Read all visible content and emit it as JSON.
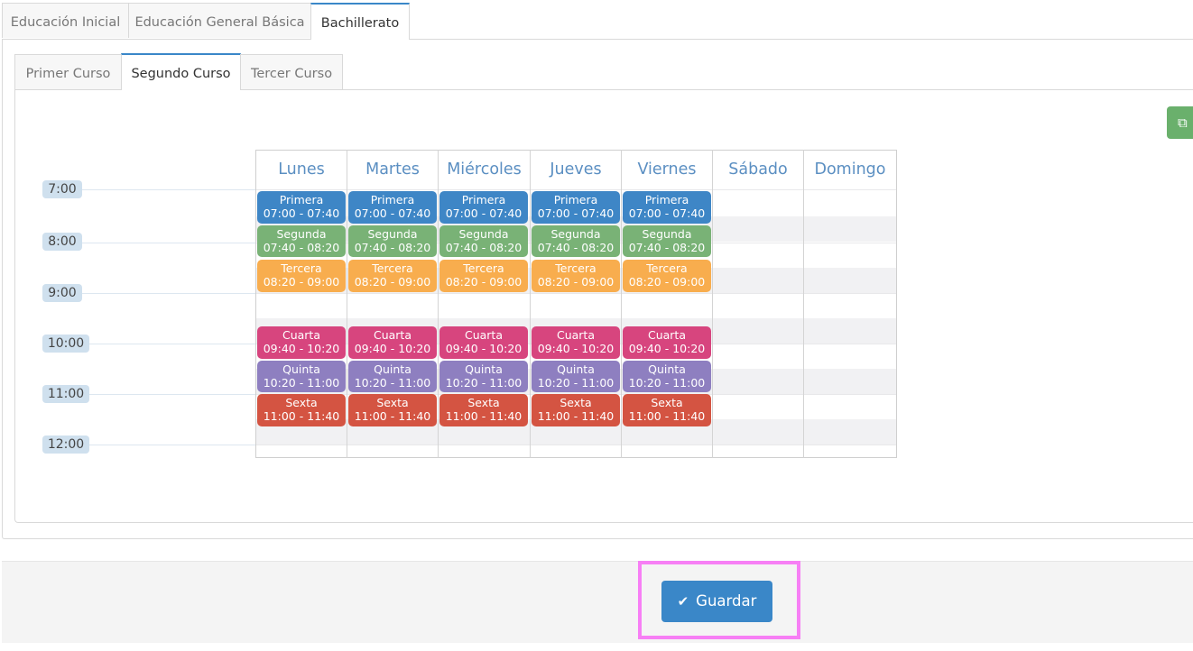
{
  "level_tabs": [
    {
      "label": "Educación Inicial",
      "active": false
    },
    {
      "label": "Educación General Básica",
      "active": false
    },
    {
      "label": "Bachillerato",
      "active": true
    }
  ],
  "course_tabs": [
    {
      "label": "Primer Curso",
      "active": false
    },
    {
      "label": "Segundo Curso",
      "active": true
    },
    {
      "label": "Tercer Curso",
      "active": false
    }
  ],
  "copy_button_icon": "copy-icon",
  "times": [
    "7:00",
    "8:00",
    "9:00",
    "10:00",
    "11:00",
    "12:00"
  ],
  "days": [
    "Lunes",
    "Martes",
    "Miércoles",
    "Jueves",
    "Viernes",
    "Sábado",
    "Domingo"
  ],
  "periods": [
    {
      "name": "Primera",
      "time": "07:00 - 07:40",
      "color": "#3e86c6"
    },
    {
      "name": "Segunda",
      "time": "07:40 - 08:20",
      "color": "#79b276"
    },
    {
      "name": "Tercera",
      "time": "08:20 - 09:00",
      "color": "#f8ad4e"
    },
    {
      "name": "Cuarta",
      "time": "09:40 - 10:20",
      "color": "#d7457e"
    },
    {
      "name": "Quinta",
      "time": "10:20 - 11:00",
      "color": "#8e7fc0"
    },
    {
      "name": "Sexta",
      "time": "11:00 - 11:40",
      "color": "#d45442"
    }
  ],
  "footer": {
    "save_label": "Guardar",
    "save_icon": "check-icon"
  }
}
